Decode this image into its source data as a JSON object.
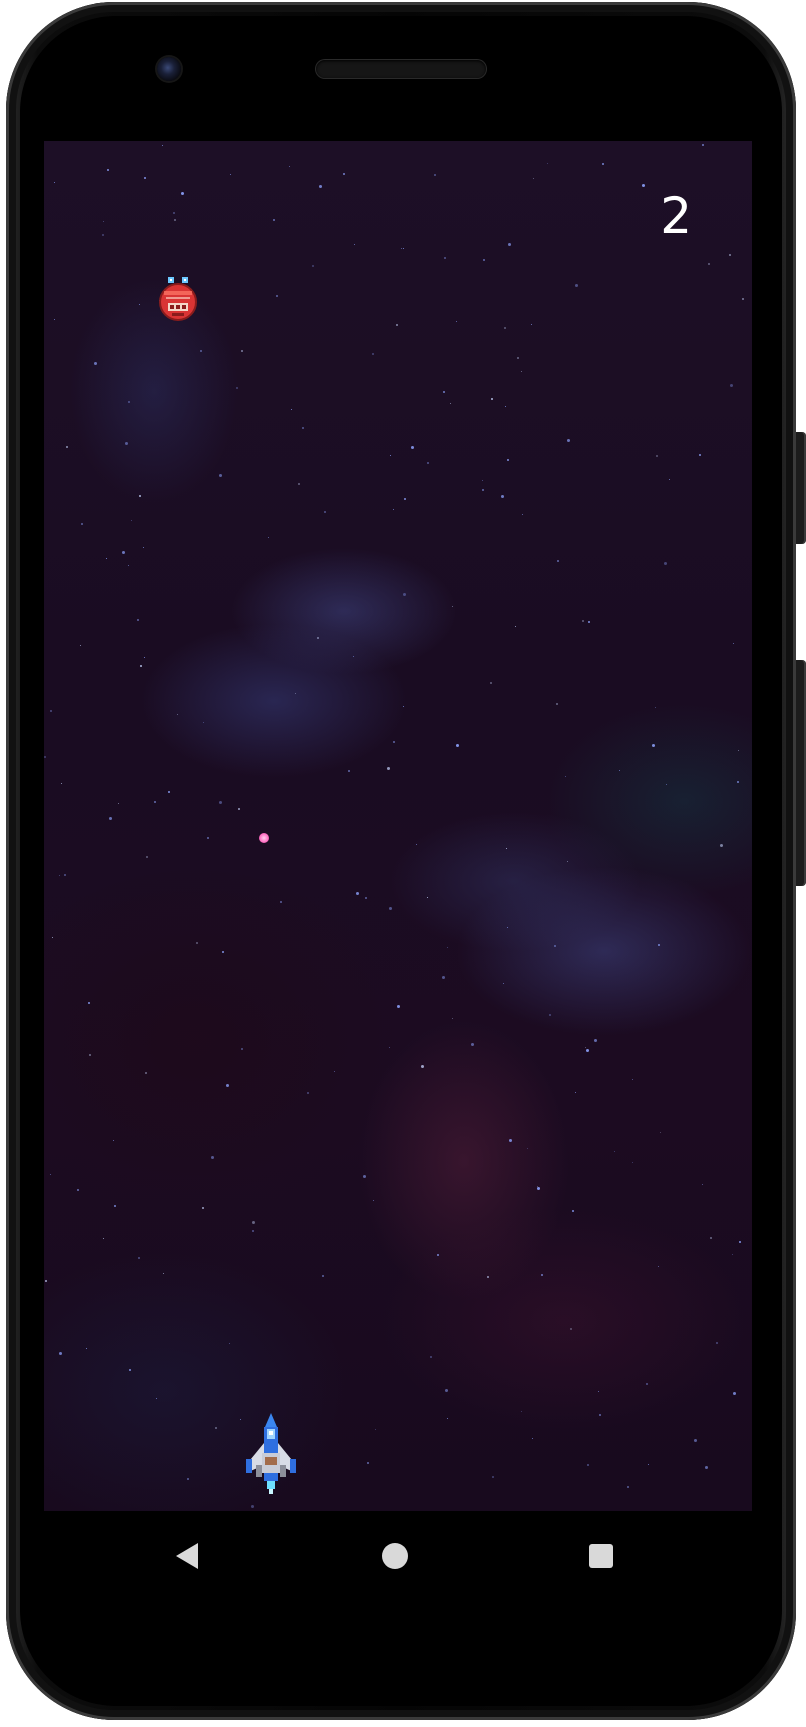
{
  "hud": {
    "score": "2"
  },
  "sprites": {
    "enemy": "red-alien-ship",
    "player": "blue-fighter-ship",
    "projectile": "pink-energy-orb"
  },
  "system_nav": {
    "back": "back-icon",
    "home": "home-icon",
    "recents": "recents-icon"
  },
  "colors": {
    "background": "#1b0c22",
    "score_text": "#ffffff",
    "enemy_red": "#e63a3a",
    "player_blue": "#2f6fe0",
    "projectile_pink": "#ff6fc3",
    "nav_icons": "#d9d9d9"
  }
}
